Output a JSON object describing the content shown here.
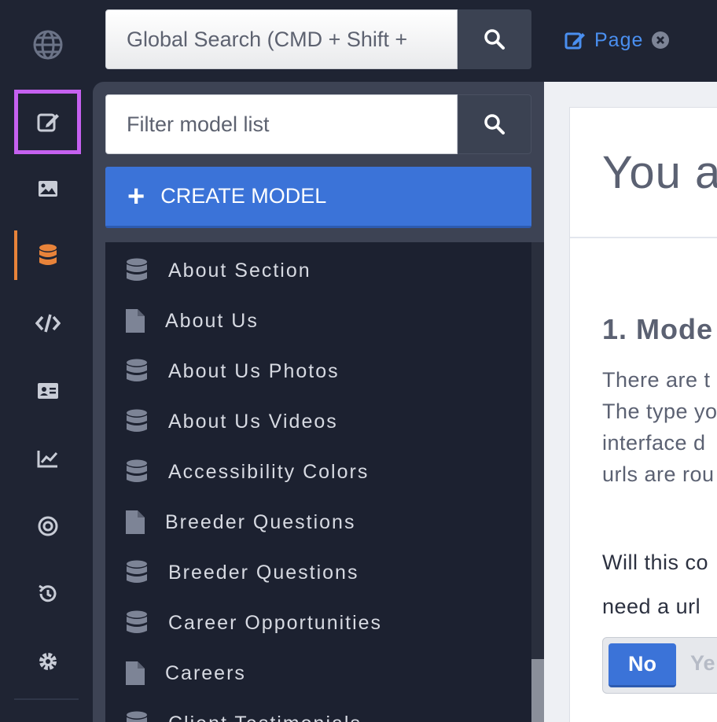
{
  "topbar": {
    "global_search_placeholder": "Global Search (CMD + Shift +",
    "page_tab_label": "Page"
  },
  "rail": {
    "items": [
      {
        "icon": "globe-icon"
      },
      {
        "icon": "edit-icon",
        "selected": true
      },
      {
        "icon": "image-icon"
      },
      {
        "icon": "database-icon",
        "active": true
      },
      {
        "icon": "code-icon"
      },
      {
        "icon": "id-card-icon"
      },
      {
        "icon": "chart-line-icon"
      },
      {
        "icon": "target-icon"
      },
      {
        "icon": "history-icon"
      },
      {
        "icon": "gear-icon"
      }
    ]
  },
  "models": {
    "filter_placeholder": "Filter model list",
    "create_label": "CREATE MODEL",
    "items": [
      {
        "label": "About Section",
        "type": "dataset"
      },
      {
        "label": "About Us",
        "type": "page"
      },
      {
        "label": "About Us Photos",
        "type": "dataset"
      },
      {
        "label": "About Us Videos",
        "type": "dataset"
      },
      {
        "label": "Accessibility Colors",
        "type": "dataset"
      },
      {
        "label": "Breeder Questions",
        "type": "page"
      },
      {
        "label": "Breeder Questions",
        "type": "dataset"
      },
      {
        "label": "Career Opportunities",
        "type": "dataset"
      },
      {
        "label": "Careers",
        "type": "page"
      },
      {
        "label": "Client Testimonials",
        "type": "dataset"
      }
    ]
  },
  "content": {
    "heading": "You a",
    "step_title": "1. Mode",
    "para_lines": [
      "There are t",
      "The type yo",
      "interface d",
      "urls are rou"
    ],
    "question_lines": [
      "Will this co",
      "need a url"
    ],
    "toggle_no": "No",
    "toggle_yes": "Ye"
  },
  "colors": {
    "accent": "#3b73d8",
    "active_marker": "#e8833a",
    "selection_outline": "#c561f0",
    "link": "#4a8ff0"
  }
}
